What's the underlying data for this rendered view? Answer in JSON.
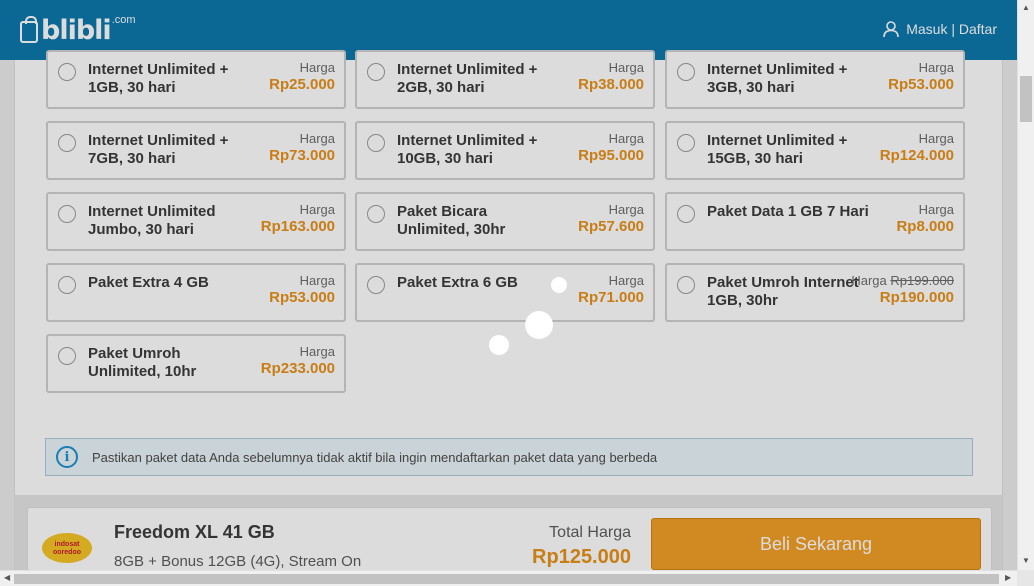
{
  "header": {
    "logo_text": "blibli",
    "logo_suffix": ".com",
    "login_label": "Masuk | Daftar"
  },
  "packages": [
    {
      "name": "Internet Unlimited + 1GB, 30 hari",
      "label": "Harga",
      "old_price": "",
      "price": "Rp25.000"
    },
    {
      "name": "Internet Unlimited + 2GB, 30 hari",
      "label": "Harga",
      "old_price": "",
      "price": "Rp38.000"
    },
    {
      "name": "Internet Unlimited + 3GB, 30 hari",
      "label": "Harga",
      "old_price": "",
      "price": "Rp53.000"
    },
    {
      "name": "Internet Unlimited + 7GB, 30 hari",
      "label": "Harga",
      "old_price": "",
      "price": "Rp73.000"
    },
    {
      "name": "Internet Unlimited + 10GB, 30 hari",
      "label": "Harga",
      "old_price": "",
      "price": "Rp95.000"
    },
    {
      "name": "Internet Unlimited + 15GB, 30 hari",
      "label": "Harga",
      "old_price": "",
      "price": "Rp124.000"
    },
    {
      "name": "Internet Unlimited Jumbo, 30 hari",
      "label": "Harga",
      "old_price": "",
      "price": "Rp163.000"
    },
    {
      "name": "Paket Bicara Unlimited, 30hr",
      "label": "Harga",
      "old_price": "",
      "price": "Rp57.600"
    },
    {
      "name": "Paket Data 1 GB 7 Hari",
      "label": "Harga",
      "old_price": "",
      "price": "Rp8.000"
    },
    {
      "name": "Paket Extra 4 GB",
      "label": "Harga",
      "old_price": "",
      "price": "Rp53.000"
    },
    {
      "name": "Paket Extra 6 GB",
      "label": "Harga",
      "old_price": "",
      "price": "Rp71.000"
    },
    {
      "name": "Paket Umroh Internet 1GB, 30hr",
      "label": "Harga",
      "old_price": "Rp199.000",
      "price": "Rp190.000"
    },
    {
      "name": "Paket Umroh Unlimited, 10hr",
      "label": "Harga",
      "old_price": "",
      "price": "Rp233.000"
    }
  ],
  "info": {
    "icon": "info-icon",
    "icon_glyph": "i",
    "text": "Pastikan paket data Anda sebelumnya tidak aktif bila ingin mendaftarkan paket data yang berbeda"
  },
  "product": {
    "brand_top": "indosat",
    "brand_bottom": "ooredoo",
    "title": "Freedom XL 41 GB",
    "description": "8GB + Bonus 12GB (4G), Stream On",
    "total_label": "Total Harga",
    "total_price": "Rp125.000",
    "buy_label": "Beli Sekarang"
  },
  "colors": {
    "header": "#0072a8",
    "price": "#e88c0d",
    "button": "#f29a1c",
    "info_bg": "#e9f4fb"
  }
}
